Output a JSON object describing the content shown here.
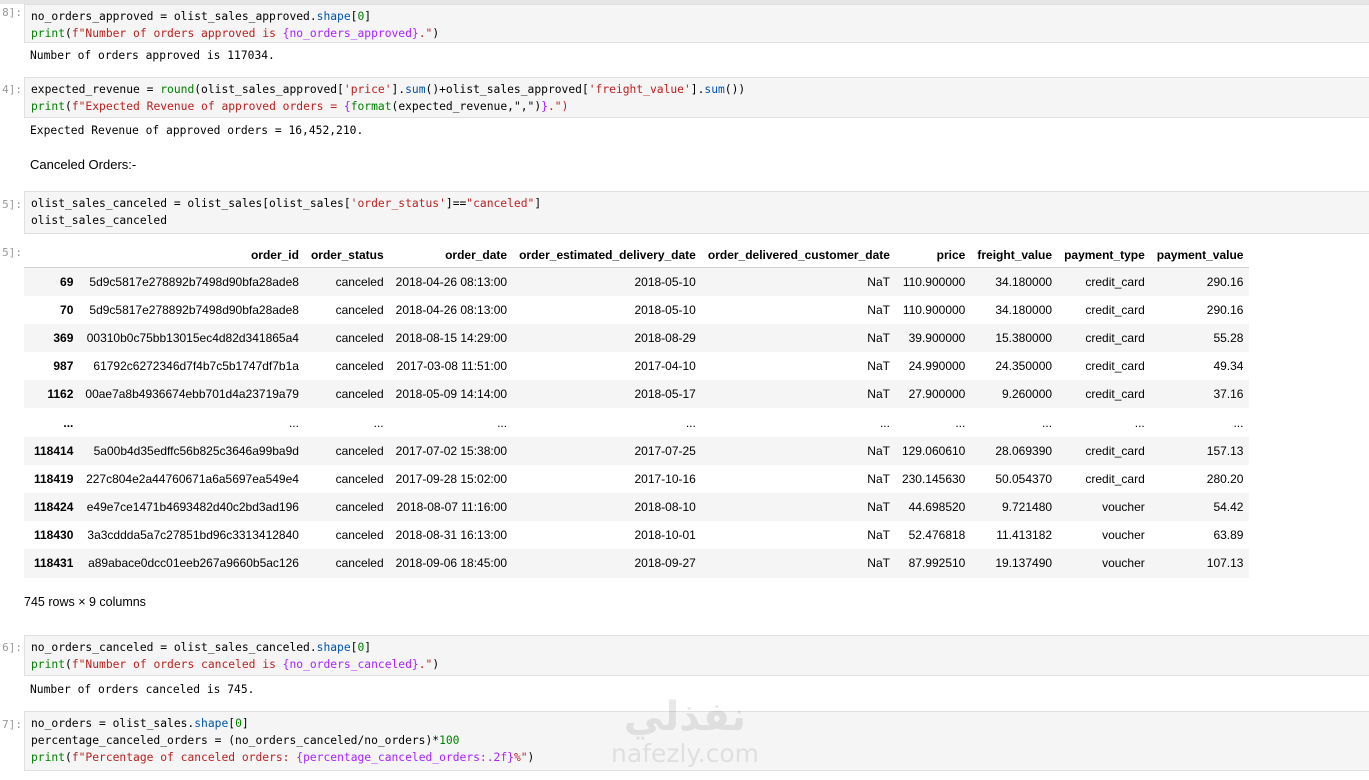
{
  "cells": {
    "c1": {
      "prompt": "8]:",
      "line1": {
        "a": "no_orders_approved = olist_sales_approved.",
        "b": "shape",
        "c": "[",
        "d": "0",
        "e": "]"
      },
      "line2": {
        "a": "print",
        "b": "(",
        "c": "f\"Number of orders approved is ",
        "d": "{no_orders_approved}",
        "e": ".\"",
        "f": ")"
      },
      "output": "Number of orders approved is 117034."
    },
    "c2": {
      "prompt": "4]:",
      "line1": {
        "a": "expected_revenue = ",
        "b": "round",
        "c": "(olist_sales_approved[",
        "d": "'price'",
        "e": "].",
        "f": "sum",
        "g": "()+olist_sales_approved[",
        "h": "'freight_value'",
        "i": "].",
        "j": "sum",
        "k": "())"
      },
      "line2": {
        "a": "print",
        "b": "(",
        "c": "f\"Expected Revenue of approved orders = ",
        "d": "{",
        "e": "format",
        "f": "(expected_revenue,\",\")",
        "g": "}",
        "h": ".\")"
      },
      "output": "Expected Revenue of approved orders = 16,452,210."
    },
    "md": {
      "text": "Canceled Orders:-"
    },
    "c3": {
      "prompt": "5]:",
      "line1": {
        "a": "olist_sales_canceled = olist_sales[olist_sales[",
        "b": "'order_status'",
        "c": "]==",
        "d": "\"canceled\"",
        "e": "]"
      },
      "line2": {
        "a": "olist_sales_canceled"
      },
      "out_prompt": "5]:"
    },
    "c4": {
      "prompt": "6]:",
      "line1": {
        "a": "no_orders_canceled = olist_sales_canceled.",
        "b": "shape",
        "c": "[",
        "d": "0",
        "e": "]"
      },
      "line2": {
        "a": "print",
        "b": "(",
        "c": "f\"Number of orders canceled is ",
        "d": "{no_orders_canceled}",
        "e": ".\"",
        "f": ")"
      },
      "output": "Number of orders canceled is 745."
    },
    "c5": {
      "prompt": "7]:",
      "line1": {
        "a": "no_orders = olist_sales.",
        "b": "shape",
        "c": "[",
        "d": "0",
        "e": "]"
      },
      "line2": {
        "a": "percentage_canceled_orders = (no_orders_canceled/no_orders)*",
        "b": "100"
      },
      "line3": {
        "a": "print",
        "b": "(",
        "c": "f\"Percentage of canceled orders: ",
        "d": "{percentage_canceled_orders:.2f}",
        "e": "%\"",
        "f": ")"
      }
    }
  },
  "dataframe": {
    "columns": [
      "order_id",
      "order_status",
      "order_date",
      "order_estimated_delivery_date",
      "order_delivered_customer_date",
      "price",
      "freight_value",
      "payment_type",
      "payment_value"
    ],
    "rows": [
      [
        "69",
        "5d9c5817e278892b7498d90bfa28ade8",
        "canceled",
        "2018-04-26 08:13:00",
        "2018-05-10",
        "NaT",
        "110.900000",
        "34.180000",
        "credit_card",
        "290.16"
      ],
      [
        "70",
        "5d9c5817e278892b7498d90bfa28ade8",
        "canceled",
        "2018-04-26 08:13:00",
        "2018-05-10",
        "NaT",
        "110.900000",
        "34.180000",
        "credit_card",
        "290.16"
      ],
      [
        "369",
        "00310b0c75bb13015ec4d82d341865a4",
        "canceled",
        "2018-08-15 14:29:00",
        "2018-08-29",
        "NaT",
        "39.900000",
        "15.380000",
        "credit_card",
        "55.28"
      ],
      [
        "987",
        "61792c6272346d7f4b7c5b1747df7b1a",
        "canceled",
        "2017-03-08 11:51:00",
        "2017-04-10",
        "NaT",
        "24.990000",
        "24.350000",
        "credit_card",
        "49.34"
      ],
      [
        "1162",
        "00ae7a8b4936674ebb701d4a23719a79",
        "canceled",
        "2018-05-09 14:14:00",
        "2018-05-17",
        "NaT",
        "27.900000",
        "9.260000",
        "credit_card",
        "37.16"
      ],
      [
        "...",
        "...",
        "...",
        "...",
        "...",
        "...",
        "...",
        "...",
        "...",
        "..."
      ],
      [
        "118414",
        "5a00b4d35edffc56b825c3646a99ba9d",
        "canceled",
        "2017-07-02 15:38:00",
        "2017-07-25",
        "NaT",
        "129.060610",
        "28.069390",
        "credit_card",
        "157.13"
      ],
      [
        "118419",
        "227c804e2a44760671a6a5697ea549e4",
        "canceled",
        "2017-09-28 15:02:00",
        "2017-10-16",
        "NaT",
        "230.145630",
        "50.054370",
        "credit_card",
        "280.20"
      ],
      [
        "118424",
        "e49e7ce1471b4693482d40c2bd3ad196",
        "canceled",
        "2018-08-07 11:16:00",
        "2018-08-10",
        "NaT",
        "44.698520",
        "9.721480",
        "voucher",
        "54.42"
      ],
      [
        "118430",
        "3a3cddda5a7c27851bd96c3313412840",
        "canceled",
        "2018-08-31 16:13:00",
        "2018-10-01",
        "NaT",
        "52.476818",
        "11.413182",
        "voucher",
        "63.89"
      ],
      [
        "118431",
        "a89abace0dcc01eeb267a9660b5ac126",
        "canceled",
        "2018-09-06 18:45:00",
        "2018-09-27",
        "NaT",
        "87.992510",
        "19.137490",
        "voucher",
        "107.13"
      ]
    ],
    "shape_note": "745 rows × 9 columns"
  },
  "watermark": {
    "arabic": "نفذلي",
    "latin": "nafezly.com"
  }
}
